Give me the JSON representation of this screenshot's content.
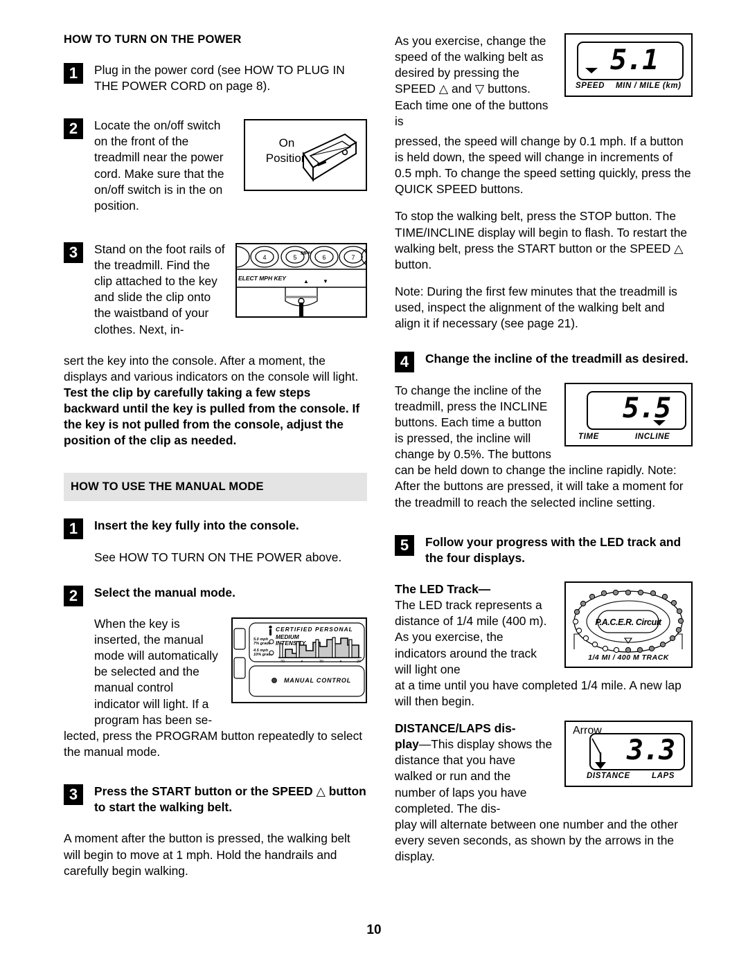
{
  "page": {
    "number": "10"
  },
  "left": {
    "section1_title": "HOW TO TURN ON THE POWER",
    "step1": {
      "num": "1",
      "text": "Plug in the power cord (see HOW TO PLUG IN THE POWER CORD on page 8)."
    },
    "step2": {
      "num": "2",
      "text": "Locate the on/off switch on the front of the treadmill near the power cord. Make sure that the on/off switch is in the on position.",
      "figure": {
        "line1": "On",
        "line2": "Position"
      }
    },
    "step3": {
      "num": "3",
      "text_wrap": "Stand on the foot rails of the treadmill. Find the clip attached to the key and slide the clip onto the waistband of your clothes. Next, in-",
      "text_rest": "sert the key into the console. After a moment, the displays and various indicators on the console will light. ",
      "text_bold": "Test the clip by carefully taking a few steps backward until the key is pulled from the console. If the key is not pulled from the console, adjust the position of the clip as needed.",
      "figure": {
        "label": "ELECT MPH KEY",
        "buttons": [
          "4",
          "5",
          "6",
          "7"
        ],
        "marks": "MPH"
      }
    },
    "section2_title": "HOW TO USE THE MANUAL MODE",
    "m_step1": {
      "num": "1",
      "heading": "Insert the key fully into the console.",
      "body": "See HOW TO TURN ON THE POWER above."
    },
    "m_step2": {
      "num": "2",
      "heading": "Select the manual mode.",
      "body_wrap": "When the key is inserted, the manual mode will automatically be selected and the manual control indicator will light. If a program has been se-",
      "body_rest": "lected, press the PROGRAM button repeatedly to select the manual mode.",
      "figure": {
        "title": "CERTIFIED PERSONAL",
        "subtitle1": "MEDIUM",
        "subtitle2": "INTENSITY",
        "led1_line1": "5.0 mph",
        "led1_line2": "7% grade",
        "led2_line1": "4.5 mph",
        "led2_line2": "10% grade",
        "axis": [
          "40",
          "30",
          "20"
        ],
        "manual_label": "MANUAL CONTROL"
      }
    },
    "m_step3": {
      "num": "3",
      "heading_a": "Press the START button or the SPEED ",
      "heading_tri": "△",
      "heading_b": " button to start the walking belt.",
      "body": "A moment after the button is pressed, the walking belt will begin to move at 1 mph. Hold the handrails and carefully begin walking."
    }
  },
  "right": {
    "p1_wrap_a": "As you exercise, change the speed of the walking belt as desired by pressing the SPEED ",
    "p1_tri_up": "△",
    "p1_wrap_b": " and ",
    "p1_tri_down": "▽",
    "p1_wrap_c": " buttons. Each time one of the buttons is",
    "p1_rest": "pressed, the speed will change by 0.1 mph. If a button is held down, the speed will change in increments of 0.5 mph. To change the speed setting quickly, press the QUICK SPEED buttons.",
    "speed_display": {
      "value": "5.1",
      "label_left": "SPEED",
      "label_right": "MIN / MILE (km)"
    },
    "p2_a": "To stop the walking belt, press the STOP button. The TIME/INCLINE display will begin to flash. To restart the walking belt, press the START button or the SPEED ",
    "p2_tri": "△",
    "p2_b": " button.",
    "p3": "Note: During the first few minutes that the treadmill is used, inspect the alignment of the walking belt and align it if necessary (see page 21).",
    "step4": {
      "num": "4",
      "heading": "Change the incline of the treadmill as desired.",
      "body_wrap": "To change the incline of the treadmill, press the INCLINE buttons. Each time a button is pressed, the incline will change by 0.5%. The buttons",
      "body_rest": "can be held down to change the incline rapidly. Note: After the buttons are pressed, it will take a moment for the treadmill to reach the selected incline setting."
    },
    "incline_display": {
      "value": "5.5",
      "label_left": "TIME",
      "label_right": "INCLINE"
    },
    "step5": {
      "num": "5",
      "heading": "Follow your progress with the LED track and the four displays."
    },
    "led_track": {
      "heading": "The LED Track—",
      "body_wrap": "The LED track represents a distance of 1/4 mile (400 m). As you exercise, the indicators around the track will light one",
      "body_rest": "at a time until you have completed 1/4 mile. A new lap will then begin.",
      "figure": {
        "logo": "P.A.C.E.R. Circuit",
        "caption": "1/4 MI / 400 M TRACK"
      }
    },
    "distance": {
      "heading_a": "DISTANCE/LAPS dis-",
      "heading_b": "play",
      "body_wrap": "—This display shows the distance that you have walked or run and the number of laps you have completed. The dis-",
      "body_rest": "play will alternate between one number and the other every seven seconds, as shown by the arrows in the display.",
      "figure": {
        "callout": "Arrow",
        "value": "3.3",
        "label_left": "DISTANCE",
        "label_right": "LAPS"
      }
    }
  }
}
